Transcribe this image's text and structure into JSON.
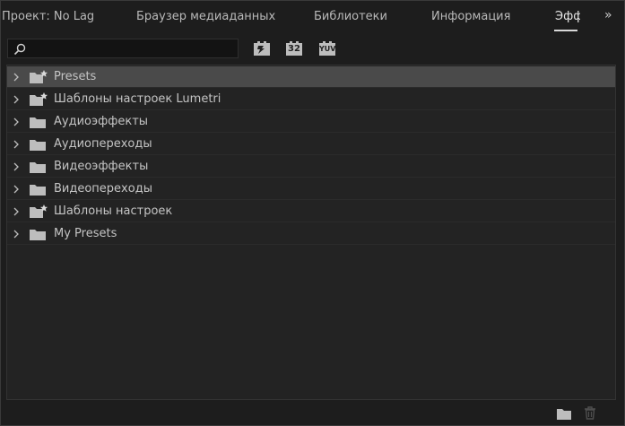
{
  "tabs": [
    {
      "label": "Проект: No Lag"
    },
    {
      "label": "Браузер медиаданных"
    },
    {
      "label": "Библиотеки"
    },
    {
      "label": "Информация"
    },
    {
      "label": "Эффекты"
    }
  ],
  "overflow_label": "»",
  "search": {
    "value": "",
    "placeholder": ""
  },
  "filter_buttons": [
    {
      "icon": "accelerated-effects-icon"
    },
    {
      "icon": "32-bit-color-icon",
      "text": "32"
    },
    {
      "icon": "yuv-effects-icon",
      "text": "YUV"
    }
  ],
  "list": [
    {
      "label": "Presets",
      "icon": "preset-folder-icon",
      "selected": true
    },
    {
      "label": "Шаблоны настроек Lumetri",
      "icon": "preset-folder-icon",
      "selected": false
    },
    {
      "label": "Аудиоэффекты",
      "icon": "folder-icon",
      "selected": false
    },
    {
      "label": "Аудиопереходы",
      "icon": "folder-icon",
      "selected": false
    },
    {
      "label": "Видеоэффекты",
      "icon": "folder-icon",
      "selected": false
    },
    {
      "label": "Видеопереходы",
      "icon": "folder-icon",
      "selected": false
    },
    {
      "label": "Шаблоны настроек",
      "icon": "preset-folder-icon",
      "selected": false
    },
    {
      "label": "My Presets",
      "icon": "folder-icon",
      "selected": false
    }
  ],
  "bottom_toolbar": [
    {
      "icon": "new-bin-icon"
    },
    {
      "icon": "trash-icon"
    }
  ],
  "colors": {
    "background": "#1d1d1d",
    "panel": "#232323",
    "selected_row": "#4a4a4a",
    "text": "#c4c4c4"
  }
}
